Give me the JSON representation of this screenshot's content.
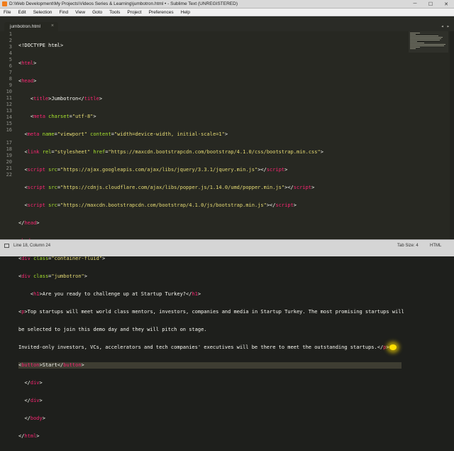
{
  "window": {
    "title": "D:\\Web Development\\My Projects\\Videos Series & Learning\\jumbotron.html • - Sublime Text (UNREGISTERED)"
  },
  "menu": [
    "File",
    "Edit",
    "Selection",
    "Find",
    "View",
    "Goto",
    "Tools",
    "Project",
    "Preferences",
    "Help"
  ],
  "tab": {
    "label": "jumbotron.html"
  },
  "gutter": [
    "1",
    "2",
    "3",
    "4",
    "5",
    "6",
    "7",
    "8",
    "9",
    "10",
    "11",
    "12",
    "13",
    "14",
    "15",
    "16",
    "",
    "17",
    "18",
    "19",
    "20",
    "21",
    "22"
  ],
  "code": {
    "l1": [
      "<!DOCTYPE html>"
    ],
    "l2": [
      "<",
      "html",
      ">"
    ],
    "l3": [
      "<",
      "head",
      ">"
    ],
    "l4": [
      "<",
      "title",
      ">",
      "Jumbotron",
      "</",
      "title",
      ">"
    ],
    "l5": [
      "<",
      "meta",
      " charset",
      "=",
      "\"utf-8\"",
      ">"
    ],
    "l6": [
      "<",
      "meta",
      " name",
      "=",
      "\"viewport\"",
      " content",
      "=",
      "\"width=device-width, initial-scale=1\"",
      ">"
    ],
    "l7": [
      "<",
      "link",
      " rel",
      "=",
      "\"stylesheet\"",
      " href",
      "=",
      "\"https://maxcdn.bootstrapcdn.com/bootstrap/4.1.0/css/bootstrap.min.css\"",
      ">"
    ],
    "l8": [
      "<",
      "script",
      " src",
      "=",
      "\"https://ajax.googleapis.com/ajax/libs/jquery/3.3.1/jquery.min.js\"",
      "></",
      "script",
      ">"
    ],
    "l9": [
      "<",
      "script",
      " src",
      "=",
      "\"https://cdnjs.cloudflare.com/ajax/libs/popper.js/1.14.0/umd/popper.min.js\"",
      "></",
      "script",
      ">"
    ],
    "l10": [
      "<",
      "script",
      " src",
      "=",
      "\"https://maxcdn.bootstrapcdn.com/bootstrap/4.1.0/js/bootstrap.min.js\"",
      "></",
      "script",
      ">"
    ],
    "l11": [
      "</",
      "head",
      ">"
    ],
    "l12": [
      "<",
      "body",
      ">"
    ],
    "l13": [
      "<",
      "div",
      " class",
      "=",
      "\"container-fluid\"",
      ">"
    ],
    "l14": [
      "<",
      "div",
      " class",
      "=",
      "\"jumbotron\"",
      ">"
    ],
    "l15": [
      "<",
      "h1",
      ">",
      "Are you ready to challenge up at Startup Turkey?",
      "</",
      "h1",
      ">"
    ],
    "l16a": [
      "<",
      "p",
      ">",
      "Top startups will meet world class mentors, investors, companies and media in Startup Turkey. The most promising startups will"
    ],
    "l16b": [
      "be selected to join this demo day and they will pitch on stage."
    ],
    "l17": [
      "Invited-only investors, VCs, accelerators and tech companies' executives will be there to meet the outstanding startups.",
      "</",
      "p",
      ">"
    ],
    "l18": [
      "<",
      "button",
      ">",
      "Start",
      "</",
      "button",
      ">"
    ],
    "l19": [
      "</",
      "div",
      ">"
    ],
    "l20": [
      "</",
      "div",
      ">"
    ],
    "l21": [
      "</",
      "body",
      ">"
    ],
    "l22": [
      "</",
      "html",
      ">"
    ]
  },
  "status": {
    "position": "Line 18, Column 24",
    "tab_size": "Tab Size: 4",
    "syntax": "HTML"
  }
}
